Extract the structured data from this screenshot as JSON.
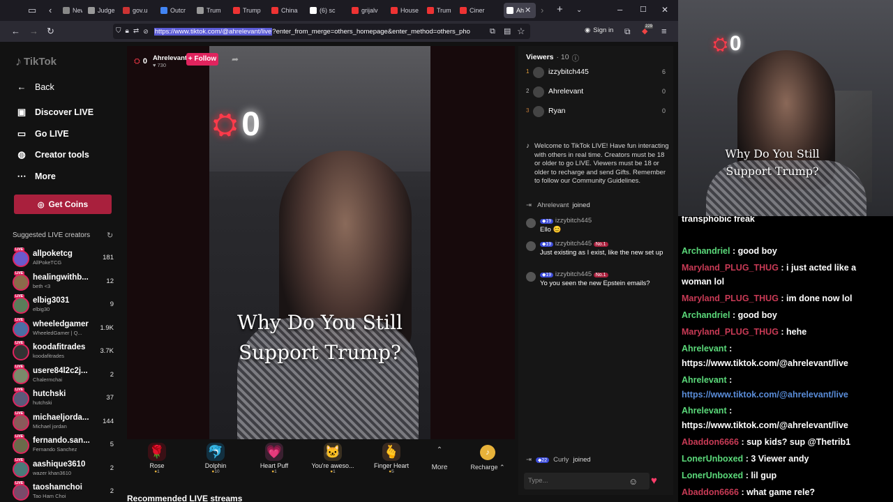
{
  "browser": {
    "tabs": [
      {
        "label": "News",
        "color": "#888"
      },
      {
        "label": "Judge",
        "color": "#999"
      },
      {
        "label": "gov.u",
        "color": "#c33"
      },
      {
        "label": "Outcr",
        "color": "#4285f4"
      },
      {
        "label": "Trum",
        "color": "#999"
      },
      {
        "label": "Trump",
        "color": "#e33"
      },
      {
        "label": "China",
        "color": "#e33"
      },
      {
        "label": "(6) sc",
        "color": "#fff"
      },
      {
        "label": "grijalv",
        "color": "#e33"
      },
      {
        "label": "House",
        "color": "#e33"
      },
      {
        "label": "Trum",
        "color": "#e33"
      },
      {
        "label": "Ciner",
        "color": "#e33"
      },
      {
        "label": "Ah",
        "color": "#fff"
      }
    ],
    "url_selected": "https://www.tiktok.com/@ahrelevant/live",
    "url_rest": "?enter_from_merge=others_homepage&enter_method=others_pho",
    "sign_in": "Sign in",
    "ext_badge": "229"
  },
  "sidebar": {
    "logo": "TikTok",
    "back": "Back",
    "nav": [
      {
        "label": "Discover LIVE",
        "icon": "tv-icon"
      },
      {
        "label": "Go LIVE",
        "icon": "camera-icon"
      },
      {
        "label": "Creator tools",
        "icon": "lightbulb-icon"
      },
      {
        "label": "More",
        "icon": "more-icon"
      }
    ],
    "coins_label": "Get Coins",
    "suggested_title": "Suggested LIVE creators",
    "creators": [
      {
        "name": "allpoketcg",
        "sub": "AllPokeTCG",
        "count": "181",
        "color": "#6a5acd"
      },
      {
        "name": "healingwithb...",
        "sub": "beth <3",
        "count": "12",
        "color": "#8b6b4a"
      },
      {
        "name": "elbig3031",
        "sub": "elbig30",
        "count": "9",
        "color": "#5a7d5a"
      },
      {
        "name": "wheeledgamer",
        "sub": "WheeledGamer | Q...",
        "count": "1.9K",
        "color": "#4a6fa5"
      },
      {
        "name": "koodafitrades",
        "sub": "koodafitrades",
        "count": "3.7K",
        "color": "#333"
      },
      {
        "name": "usere84l2c2j...",
        "sub": "Chalermchai",
        "count": "2",
        "color": "#7a8a6a"
      },
      {
        "name": "hutchski",
        "sub": "hutchski",
        "count": "37",
        "color": "#5a5a7a"
      },
      {
        "name": "michaeljorda...",
        "sub": "Michael jordan",
        "count": "144",
        "color": "#8a5a5a"
      },
      {
        "name": "fernando.san...",
        "sub": "Fernando Sanchez",
        "count": "5",
        "color": "#6a6a4a"
      },
      {
        "name": "aashique3610",
        "sub": "wazer khan3610",
        "count": "2",
        "color": "#4a7a7a"
      },
      {
        "name": "taoshamchoi",
        "sub": "Tao Ham Choi",
        "count": "2",
        "color": "#7a4a6a"
      }
    ]
  },
  "stream": {
    "host_badge": "0",
    "host_name": "Ahrelevant",
    "host_likes": "730",
    "follow_label": "+ Follow",
    "sign_digit": "0",
    "caption_line1": "Why Do You Still",
    "caption_line2": "Support Trump?",
    "recommended": "Recommended LIVE streams"
  },
  "gifts": [
    {
      "name": "Rose",
      "price": "1",
      "icon": "rose-icon",
      "glyph": "🌹",
      "bg": "#3a1015"
    },
    {
      "name": "Dolphin",
      "price": "10",
      "icon": "dolphin-icon",
      "glyph": "🐬",
      "bg": "#123040"
    },
    {
      "name": "Heart Puff",
      "price": "1",
      "icon": "heart-puff-icon",
      "glyph": "💗",
      "bg": "#3a2030"
    },
    {
      "name": "You're aweso...",
      "price": "1",
      "icon": "cat-icon",
      "glyph": "🐱",
      "bg": "#3a3020"
    },
    {
      "name": "Finger Heart",
      "price": "5",
      "icon": "finger-heart-icon",
      "glyph": "🫰",
      "bg": "#3a2a20"
    }
  ],
  "gift_more": "More",
  "recharge": "Recharge",
  "viewers": {
    "title": "Viewers",
    "count": "· 10",
    "list": [
      {
        "rank": "1",
        "name": "izzybitch445",
        "score": "6",
        "rank_color": "#e6a23c"
      },
      {
        "rank": "2",
        "name": "Ahrelevant",
        "score": "0",
        "rank_color": "#bbb"
      },
      {
        "rank": "3",
        "name": "Ryan",
        "score": "0",
        "rank_color": "#c77d3a"
      }
    ]
  },
  "chat": {
    "welcome": "Welcome to TikTok LIVE! Have fun interacting with others in real time. Creators must be 18 or older to go LIVE. Viewers must be 18 or older to recharge and send Gifts. Remember to follow our Community Guidelines.",
    "joined_name": "Ahrelevant",
    "joined_word": "joined",
    "messages": [
      {
        "level": "19",
        "user": "izzybitch445",
        "badge": "",
        "text": "Ello 😊"
      },
      {
        "level": "19",
        "user": "izzybitch445",
        "badge": "No.1",
        "text": "Just existing as I exist, like the new set up"
      },
      {
        "level": "19",
        "user": "izzybitch445",
        "badge": "No.1",
        "text": "Yo you seen the new Epstein emails?"
      }
    ],
    "last_join_level": "22",
    "last_join_name": "Curly",
    "last_join_word": "joined",
    "input_placeholder": "Type..."
  },
  "overlay": {
    "cam_digit": "0",
    "caption_line1": "Why Do You Still",
    "caption_line2": "Support Trump?",
    "lines": [
      {
        "user": "",
        "text": "transphobic freak",
        "color": "#fff"
      },
      {
        "user": "Archandriel",
        "text": ": good boy",
        "color": "#5bd97a"
      },
      {
        "user": "Maryland_PLUG_THUG",
        "text": ": i just acted like a woman lol",
        "color": "#c83a55"
      },
      {
        "user": "Maryland_PLUG_THUG",
        "text": ": im done now lol",
        "color": "#c83a55"
      },
      {
        "user": "Archandriel",
        "text": ": good boy",
        "color": "#5bd97a"
      },
      {
        "user": "Maryland_PLUG_THUG",
        "text": ": hehe",
        "color": "#c83a55"
      },
      {
        "user": "Ahrelevant",
        "text": ":",
        "color": "#5bd97a"
      },
      {
        "user": "",
        "text": "https://www.tiktok.com/@ahrelevant/live",
        "color": "#fff"
      },
      {
        "user": "Ahrelevant",
        "text": ":",
        "color": "#5bd97a"
      },
      {
        "user": "",
        "text": "https://www.tiktok.com/@ahrelevant/live",
        "color": "#5a8dd9"
      },
      {
        "user": "Ahrelevant",
        "text": ":",
        "color": "#5bd97a"
      },
      {
        "user": "",
        "text": "https://www.tiktok.com/@ahrelevant/live",
        "color": "#fff"
      },
      {
        "user": "Abaddon6666",
        "text": ": sup kids? sup @Thetrib1",
        "color": "#c83a55"
      },
      {
        "user": "LonerUnboxed",
        "text": ": 3 Viewer andy",
        "color": "#5bd97a"
      },
      {
        "user": "LonerUnboxed",
        "text": ": lil gup",
        "color": "#5bd97a"
      },
      {
        "user": "Abaddon6666",
        "text": ": what game rele?",
        "color": "#c83a55"
      }
    ]
  }
}
